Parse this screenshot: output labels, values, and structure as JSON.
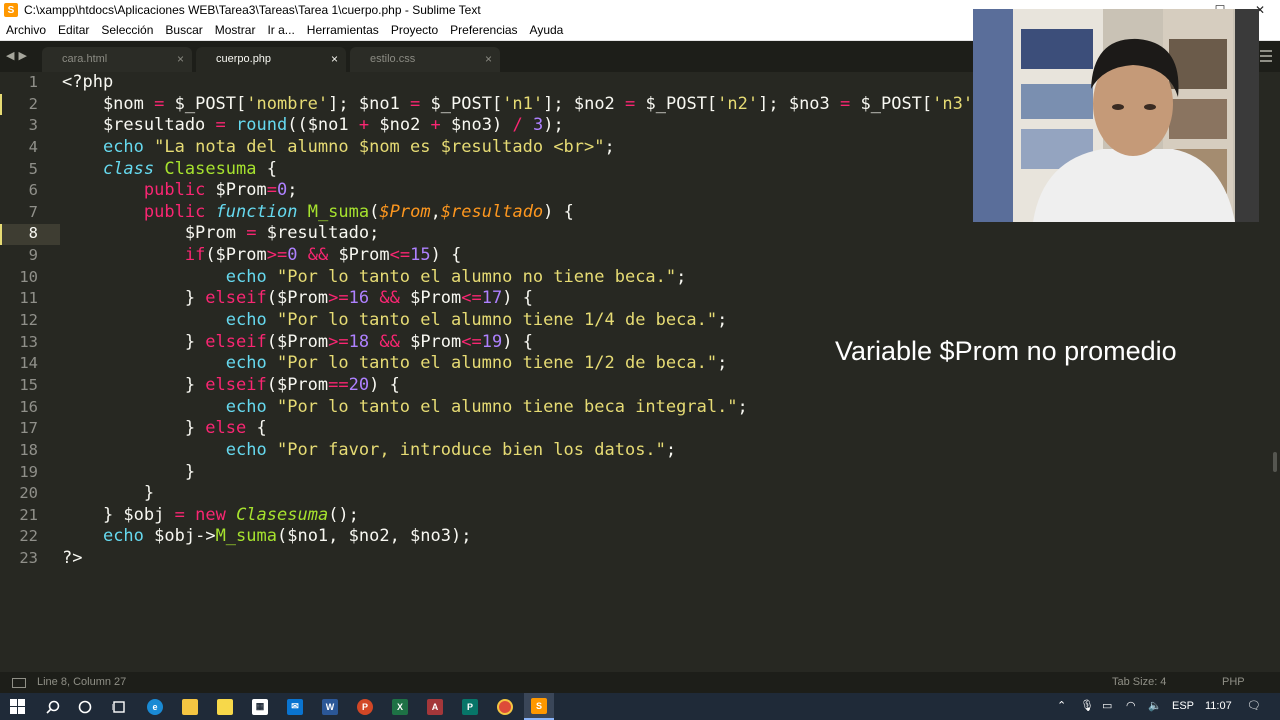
{
  "window": {
    "title": "C:\\xampp\\htdocs\\Aplicaciones WEB\\Tarea3\\Tareas\\Tarea 1\\cuerpo.php - Sublime Text",
    "app_icon": "sublime-icon",
    "controls": [
      "—",
      "☐",
      "✕"
    ]
  },
  "menu": [
    "Archivo",
    "Editar",
    "Selección",
    "Buscar",
    "Mostrar",
    "Ir a...",
    "Herramientas",
    "Proyecto",
    "Preferencias",
    "Ayuda"
  ],
  "tabs": [
    {
      "label": "cara.html",
      "active": false,
      "close": "×"
    },
    {
      "label": "cuerpo.php",
      "active": true,
      "close": "×"
    },
    {
      "label": "estilo.css",
      "active": false,
      "close": "×"
    }
  ],
  "editor": {
    "line_numbers": [
      "1",
      "2",
      "3",
      "4",
      "5",
      "6",
      "7",
      "8",
      "9",
      "10",
      "11",
      "12",
      "13",
      "14",
      "15",
      "16",
      "17",
      "18",
      "19",
      "20",
      "21",
      "22",
      "23"
    ],
    "current_line": 8,
    "lines": [
      [
        [
          "",
          "<?php"
        ]
      ],
      [
        [
          "",
          "    $nom "
        ],
        [
          "kw",
          "="
        ],
        [
          "",
          " $_POST["
        ],
        [
          "st",
          "'nombre'"
        ],
        [
          "",
          "]; $no1 "
        ],
        [
          "kw",
          "="
        ],
        [
          "",
          " $_POST["
        ],
        [
          "st",
          "'n1'"
        ],
        [
          "",
          "]; $no2 "
        ],
        [
          "kw",
          "="
        ],
        [
          "",
          " $_POST["
        ],
        [
          "st",
          "'n2'"
        ],
        [
          "",
          "]; $no3 "
        ],
        [
          "kw",
          "="
        ],
        [
          "",
          " $_POST["
        ],
        [
          "st",
          "'n3'"
        ],
        [
          "",
          "];"
        ]
      ],
      [
        [
          "",
          "    $resultado "
        ],
        [
          "kw",
          "="
        ],
        [
          "",
          " "
        ],
        [
          "bi",
          "round"
        ],
        [
          "",
          "(($no1 "
        ],
        [
          "kw",
          "+"
        ],
        [
          "",
          " $no2 "
        ],
        [
          "kw",
          "+"
        ],
        [
          "",
          " $no3) "
        ],
        [
          "kw",
          "/"
        ],
        [
          "",
          " "
        ],
        [
          "nm",
          "3"
        ],
        [
          "",
          "); "
        ]
      ],
      [
        [
          "",
          "    "
        ],
        [
          "bi",
          "echo"
        ],
        [
          "",
          " "
        ],
        [
          "st",
          "\"La nota del alumno $nom es $resultado <br>\""
        ],
        [
          "",
          ";"
        ]
      ],
      [
        [
          "",
          "    "
        ],
        [
          "bii",
          "class"
        ],
        [
          "",
          " "
        ],
        [
          "cl",
          "Clasesuma"
        ],
        [
          "",
          " {"
        ]
      ],
      [
        [
          "",
          "        "
        ],
        [
          "kw",
          "public"
        ],
        [
          "",
          " $Prom"
        ],
        [
          "kw",
          "="
        ],
        [
          "nm",
          "0"
        ],
        [
          "",
          ";"
        ]
      ],
      [
        [
          "",
          "        "
        ],
        [
          "kw",
          "public"
        ],
        [
          "",
          " "
        ],
        [
          "bii",
          "function"
        ],
        [
          "",
          " "
        ],
        [
          "fn",
          "M_suma"
        ],
        [
          "",
          "("
        ],
        [
          "pa",
          "$Prom"
        ],
        [
          "",
          ","
        ],
        [
          "pa",
          "$resultado"
        ],
        [
          "",
          ") {"
        ]
      ],
      [
        [
          "",
          "            $Prom "
        ],
        [
          "kw",
          "="
        ],
        [
          "",
          " $resultado;"
        ]
      ],
      [
        [
          "",
          "            "
        ],
        [
          "kw",
          "if"
        ],
        [
          "",
          "($Prom"
        ],
        [
          "kw",
          ">="
        ],
        [
          "nm",
          "0"
        ],
        [
          "",
          " "
        ],
        [
          "kw",
          "&&"
        ],
        [
          "",
          " $Prom"
        ],
        [
          "kw",
          "<="
        ],
        [
          "nm",
          "15"
        ],
        [
          "",
          ") {"
        ]
      ],
      [
        [
          "",
          "                "
        ],
        [
          "bi",
          "echo"
        ],
        [
          "",
          " "
        ],
        [
          "st",
          "\"Por lo tanto el alumno no tiene beca.\""
        ],
        [
          "",
          ";"
        ]
      ],
      [
        [
          "",
          "            } "
        ],
        [
          "kw",
          "elseif"
        ],
        [
          "",
          "($Prom"
        ],
        [
          "kw",
          ">="
        ],
        [
          "nm",
          "16"
        ],
        [
          "",
          " "
        ],
        [
          "kw",
          "&&"
        ],
        [
          "",
          " $Prom"
        ],
        [
          "kw",
          "<="
        ],
        [
          "nm",
          "17"
        ],
        [
          "",
          ") {"
        ]
      ],
      [
        [
          "",
          "                "
        ],
        [
          "bi",
          "echo"
        ],
        [
          "",
          " "
        ],
        [
          "st",
          "\"Por lo tanto el alumno tiene 1/4 de beca.\""
        ],
        [
          "",
          ";"
        ]
      ],
      [
        [
          "",
          "            } "
        ],
        [
          "kw",
          "elseif"
        ],
        [
          "",
          "($Prom"
        ],
        [
          "kw",
          ">="
        ],
        [
          "nm",
          "18"
        ],
        [
          "",
          " "
        ],
        [
          "kw",
          "&&"
        ],
        [
          "",
          " $Prom"
        ],
        [
          "kw",
          "<="
        ],
        [
          "nm",
          "19"
        ],
        [
          "",
          ") {"
        ]
      ],
      [
        [
          "",
          "                "
        ],
        [
          "bi",
          "echo"
        ],
        [
          "",
          " "
        ],
        [
          "st",
          "\"Por lo tanto el alumno tiene 1/2 de beca.\""
        ],
        [
          "",
          ";"
        ]
      ],
      [
        [
          "",
          "            } "
        ],
        [
          "kw",
          "elseif"
        ],
        [
          "",
          "($Prom"
        ],
        [
          "kw",
          "=="
        ],
        [
          "nm",
          "20"
        ],
        [
          "",
          ") {"
        ]
      ],
      [
        [
          "",
          "                "
        ],
        [
          "bi",
          "echo"
        ],
        [
          "",
          " "
        ],
        [
          "st",
          "\"Por lo tanto el alumno tiene beca integral.\""
        ],
        [
          "",
          ";"
        ]
      ],
      [
        [
          "",
          "            } "
        ],
        [
          "kw",
          "else"
        ],
        [
          "",
          " {"
        ]
      ],
      [
        [
          "",
          "                "
        ],
        [
          "bi",
          "echo"
        ],
        [
          "",
          " "
        ],
        [
          "st",
          "\"Por favor, introduce bien los datos.\""
        ],
        [
          "",
          ";"
        ]
      ],
      [
        [
          "",
          "            }"
        ]
      ],
      [
        [
          "",
          "        }"
        ]
      ],
      [
        [
          "",
          "    } $obj "
        ],
        [
          "kw",
          "="
        ],
        [
          "",
          " "
        ],
        [
          "kw",
          "new"
        ],
        [
          "",
          " "
        ],
        [
          "cli",
          "Clasesuma"
        ],
        [
          "",
          "();"
        ]
      ],
      [
        [
          "",
          "    "
        ],
        [
          "bi",
          "echo"
        ],
        [
          "",
          " $obj->"
        ],
        [
          "fn",
          "M_suma"
        ],
        [
          "",
          "($no1, $no2, $no3);"
        ]
      ],
      [
        [
          "",
          "?>"
        ]
      ]
    ]
  },
  "caption": "Variable $Prom no promedio",
  "status": {
    "position": "Line 8, Column 27",
    "tab_size": "Tab Size: 4",
    "syntax": "PHP"
  },
  "taskbar": {
    "apps": [
      "windows-icon",
      "search-icon",
      "cortana-icon",
      "task-view-icon",
      "edge-icon",
      "file-explorer-icon",
      "sticky-notes-icon",
      "store-icon",
      "mail-icon",
      "word-icon",
      "powerpoint-icon",
      "excel-icon",
      "access-icon",
      "publisher-icon",
      "chrome-icon",
      "sublime-icon"
    ],
    "language": "ESP",
    "time": "11:07"
  },
  "colors": {
    "editor_bg": "#272822",
    "keyword": "#f92672",
    "string": "#e6db74",
    "number": "#ae81ff",
    "function": "#a6e22e",
    "builtin": "#66d9ef",
    "param": "#fd971f"
  }
}
